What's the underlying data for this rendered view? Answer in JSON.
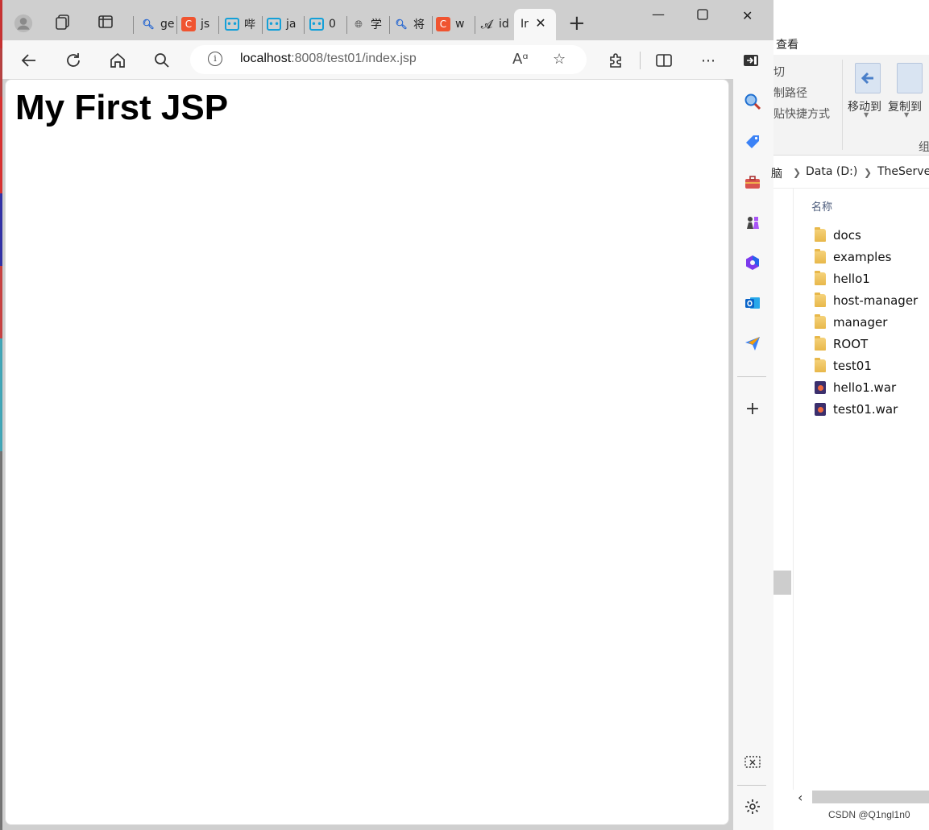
{
  "browser": {
    "tabs": [
      {
        "favicon": "search-icon",
        "label": "ge"
      },
      {
        "favicon": "csdn-logo-icon",
        "label": "js"
      },
      {
        "favicon": "bilibili-icon",
        "label": "哔"
      },
      {
        "favicon": "bilibili-icon",
        "label": "ja"
      },
      {
        "favicon": "bilibili-icon",
        "label": "0"
      },
      {
        "favicon": "globe-icon",
        "label": "学"
      },
      {
        "favicon": "search-icon",
        "label": "将"
      },
      {
        "favicon": "csdn-logo-icon",
        "label": "w"
      },
      {
        "favicon": "page-icon",
        "label": "id"
      }
    ],
    "active_tab": {
      "label": "Ir"
    },
    "address": {
      "host": "localhost",
      "rest": ":8008/test01/index.jsp"
    }
  },
  "page": {
    "heading": "My First JSP"
  },
  "explorer": {
    "ribbon_tab": "查看",
    "ribbon_small": [
      "切",
      "制路径",
      "贴快捷方式"
    ],
    "move_to": "移动到",
    "copy_to": "复制到",
    "group_label": "组",
    "breadcrumb": [
      "脑",
      "Data (D:)",
      "TheServe"
    ],
    "column_name": "名称",
    "files": [
      {
        "name": "docs",
        "type": "folder"
      },
      {
        "name": "examples",
        "type": "folder"
      },
      {
        "name": "hello1",
        "type": "folder"
      },
      {
        "name": "host-manager",
        "type": "folder"
      },
      {
        "name": "manager",
        "type": "folder"
      },
      {
        "name": "ROOT",
        "type": "folder"
      },
      {
        "name": "test01",
        "type": "folder"
      },
      {
        "name": "hello1.war",
        "type": "war"
      },
      {
        "name": "test01.war",
        "type": "war"
      }
    ]
  },
  "watermark": "CSDN @Q1ngl1n0"
}
